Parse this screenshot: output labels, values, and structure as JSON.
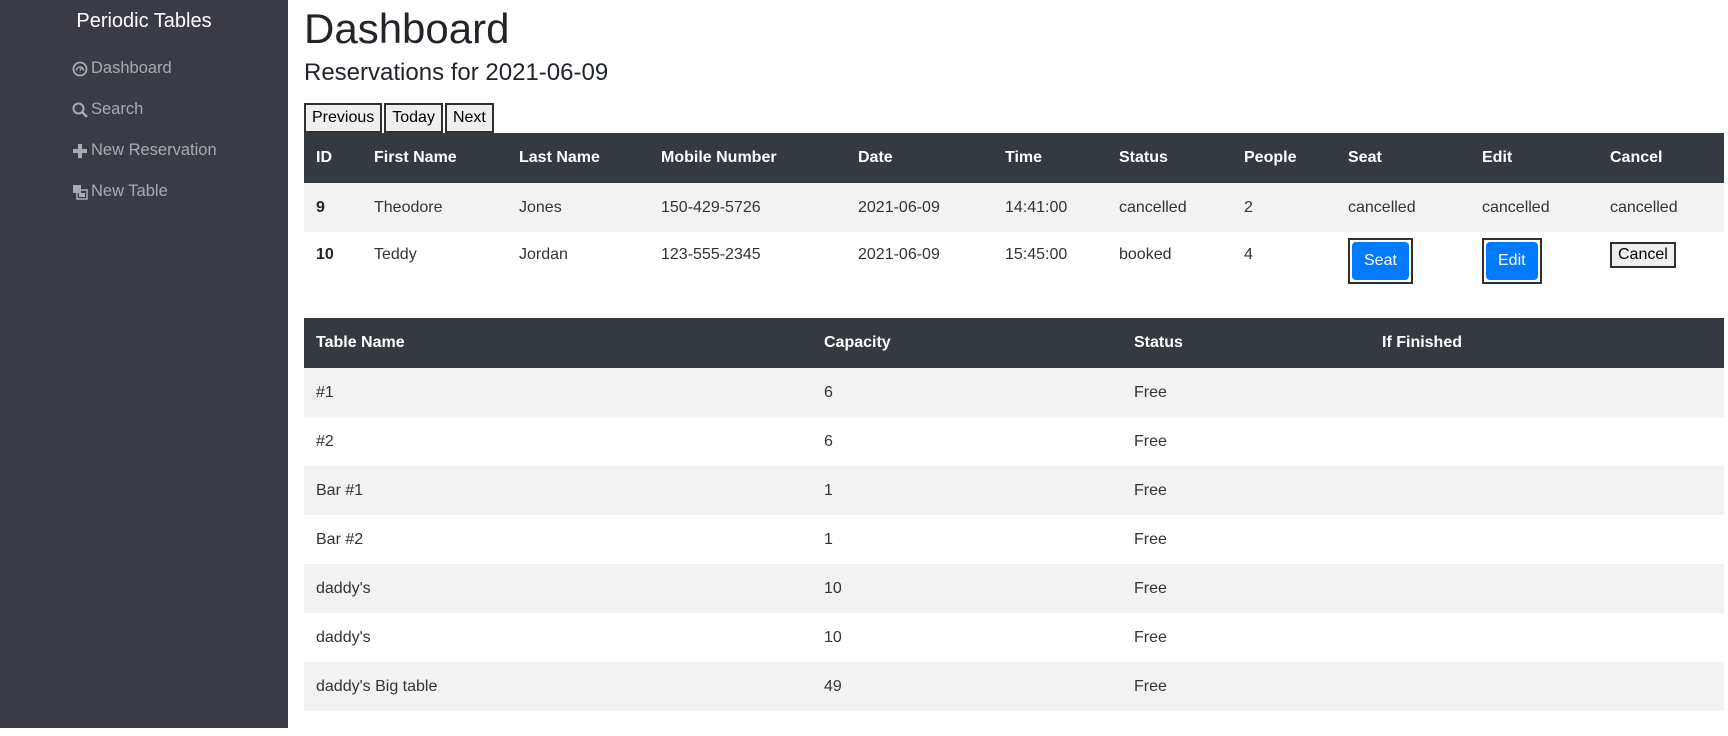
{
  "sidebar": {
    "brand": "Periodic Tables",
    "items": [
      {
        "label": "Dashboard",
        "icon": "dashboard-icon"
      },
      {
        "label": "Search",
        "icon": "search-icon"
      },
      {
        "label": "New Reservation",
        "icon": "plus-icon"
      },
      {
        "label": "New Table",
        "icon": "table-icon"
      }
    ]
  },
  "main": {
    "title": "Dashboard",
    "subtitle": "Reservations for 2021-06-09",
    "nav_buttons": {
      "previous": "Previous",
      "today": "Today",
      "next": "Next"
    }
  },
  "reservations": {
    "headers": [
      "ID",
      "First Name",
      "Last Name",
      "Mobile Number",
      "Date",
      "Time",
      "Status",
      "People",
      "Seat",
      "Edit",
      "Cancel"
    ],
    "rows": [
      {
        "id": "9",
        "first_name": "Theodore",
        "last_name": "Jones",
        "mobile": "150-429-5726",
        "date": "2021-06-09",
        "time": "14:41:00",
        "status": "cancelled",
        "people": "2",
        "seat": "cancelled",
        "edit": "cancelled",
        "cancel": "cancelled"
      },
      {
        "id": "10",
        "first_name": "Teddy",
        "last_name": "Jordan",
        "mobile": "123-555-2345",
        "date": "2021-06-09",
        "time": "15:45:00",
        "status": "booked",
        "people": "4",
        "seat": "Seat",
        "edit": "Edit",
        "cancel": "Cancel"
      }
    ]
  },
  "tables": {
    "headers": [
      "Table Name",
      "Capacity",
      "Status",
      "If Finished"
    ],
    "rows": [
      {
        "name": "#1",
        "capacity": "6",
        "status": "Free"
      },
      {
        "name": "#2",
        "capacity": "6",
        "status": "Free"
      },
      {
        "name": "Bar #1",
        "capacity": "1",
        "status": "Free"
      },
      {
        "name": "Bar #2",
        "capacity": "1",
        "status": "Free"
      },
      {
        "name": "daddy's",
        "capacity": "10",
        "status": "Free"
      },
      {
        "name": "daddy's",
        "capacity": "10",
        "status": "Free"
      },
      {
        "name": "daddy's Big table",
        "capacity": "49",
        "status": "Free"
      }
    ]
  },
  "colors": {
    "sidebar_bg": "#3a3b44",
    "header_bg": "#343a40",
    "primary": "#007bff",
    "stripe": "#f2f2f2"
  }
}
